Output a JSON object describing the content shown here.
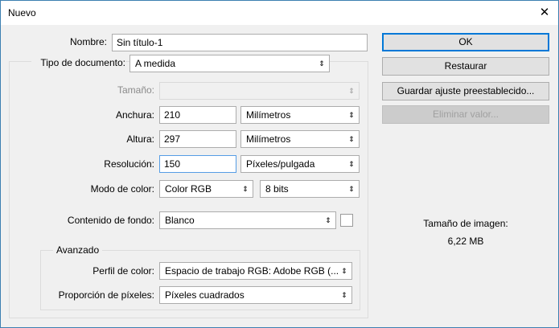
{
  "window": {
    "title": "Nuevo",
    "close_glyph": "✕"
  },
  "name_label": "Nombre:",
  "name_value": "Sin título-1",
  "doc_type": {
    "label": "Tipo de documento:",
    "value": "A medida"
  },
  "size": {
    "label": "Tamaño:",
    "value": ""
  },
  "width": {
    "label": "Anchura:",
    "value": "210",
    "unit": "Milímetros"
  },
  "height": {
    "label": "Altura:",
    "value": "297",
    "unit": "Milímetros"
  },
  "resolution": {
    "label": "Resolución:",
    "value": "150",
    "unit": "Píxeles/pulgada"
  },
  "color_mode": {
    "label": "Modo de color:",
    "value": "Color RGB",
    "bits": "8 bits"
  },
  "background": {
    "label": "Contenido de fondo:",
    "value": "Blanco",
    "swatch_color": "#ffffff"
  },
  "advanced": {
    "legend": "Avanzado",
    "profile": {
      "label": "Perfil de color:",
      "value": "Espacio de trabajo RGB: Adobe RGB (..."
    },
    "pixel_aspect": {
      "label": "Proporción de píxeles:",
      "value": "Píxeles cuadrados"
    }
  },
  "buttons": {
    "ok": "OK",
    "reset": "Restaurar",
    "save_preset": "Guardar ajuste preestablecido...",
    "delete_preset": "Eliminar valor..."
  },
  "image_size": {
    "label": "Tamaño de imagen:",
    "value": "6,22 MB"
  },
  "colors": {
    "accent": "#0078d7",
    "window_border": "#3c7fb1",
    "background": "#f0f0f0"
  }
}
